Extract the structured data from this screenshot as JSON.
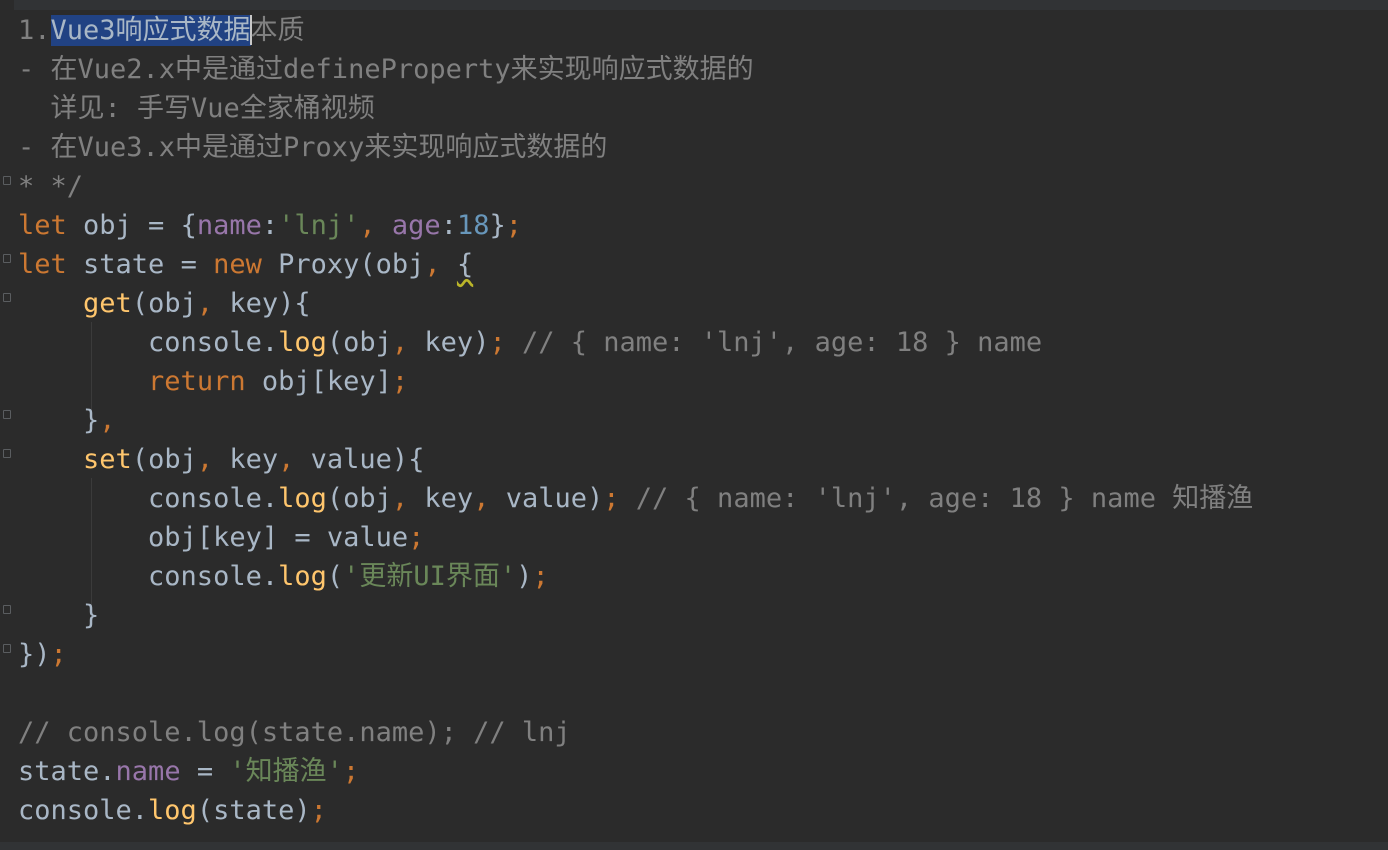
{
  "editor": {
    "lines": [
      {
        "id": "l1",
        "segs": [
          {
            "t": "1.",
            "c": "cmt"
          },
          {
            "t": "Vue3响应式数据",
            "c": "sel"
          },
          {
            "t": "本质",
            "c": "cmt"
          }
        ]
      },
      {
        "id": "l2",
        "segs": [
          {
            "t": "- 在Vue2.x中是通过defineProperty来实现响应式数据的",
            "c": "cmt"
          }
        ]
      },
      {
        "id": "l3",
        "segs": [
          {
            "t": "  详见: 手写Vue全家桶视频",
            "c": "cmt"
          }
        ]
      },
      {
        "id": "l4",
        "segs": [
          {
            "t": "- 在Vue3.x中是通过Proxy来实现响应式数据的",
            "c": "cmt"
          }
        ]
      },
      {
        "id": "l5",
        "segs": [
          {
            "t": "* */",
            "c": "cmt"
          }
        ]
      },
      {
        "id": "l6",
        "segs": [
          {
            "t": "let ",
            "c": "kw"
          },
          {
            "t": "obj = {",
            "c": ""
          },
          {
            "t": "name",
            "c": "prop"
          },
          {
            "t": ":",
            "c": ""
          },
          {
            "t": "'lnj'",
            "c": "str"
          },
          {
            "t": ", ",
            "c": "kw"
          },
          {
            "t": "age",
            "c": "prop"
          },
          {
            "t": ":",
            "c": ""
          },
          {
            "t": "18",
            "c": "num"
          },
          {
            "t": "}",
            "c": ""
          },
          {
            "t": ";",
            "c": "kw"
          }
        ]
      },
      {
        "id": "l7",
        "segs": [
          {
            "t": "let ",
            "c": "kw"
          },
          {
            "t": "state = ",
            "c": ""
          },
          {
            "t": "new ",
            "c": "kw"
          },
          {
            "t": "Proxy(obj",
            "c": ""
          },
          {
            "t": ", ",
            "c": "kw"
          },
          {
            "t": "{",
            "c": "squiggle"
          }
        ]
      },
      {
        "id": "l8",
        "segs": [
          {
            "t": "    ",
            "c": ""
          },
          {
            "t": "get",
            "c": "fn"
          },
          {
            "t": "(obj",
            "c": ""
          },
          {
            "t": ", ",
            "c": "kw"
          },
          {
            "t": "key){",
            "c": ""
          }
        ]
      },
      {
        "id": "l9",
        "segs": [
          {
            "t": "        console.",
            "c": ""
          },
          {
            "t": "log",
            "c": "fnlog"
          },
          {
            "t": "(obj",
            "c": ""
          },
          {
            "t": ", ",
            "c": "kw"
          },
          {
            "t": "key)",
            "c": ""
          },
          {
            "t": "; ",
            "c": "kw"
          },
          {
            "t": "// { name: 'lnj', age: 18 } name",
            "c": "cmt"
          }
        ]
      },
      {
        "id": "l10",
        "segs": [
          {
            "t": "        ",
            "c": ""
          },
          {
            "t": "return ",
            "c": "kw"
          },
          {
            "t": "obj[key]",
            "c": ""
          },
          {
            "t": ";",
            "c": "kw"
          }
        ]
      },
      {
        "id": "l11",
        "segs": [
          {
            "t": "    }",
            "c": ""
          },
          {
            "t": ",",
            "c": "kw"
          }
        ]
      },
      {
        "id": "l12",
        "segs": [
          {
            "t": "    ",
            "c": ""
          },
          {
            "t": "set",
            "c": "fn"
          },
          {
            "t": "(obj",
            "c": ""
          },
          {
            "t": ", ",
            "c": "kw"
          },
          {
            "t": "key",
            "c": ""
          },
          {
            "t": ", ",
            "c": "kw"
          },
          {
            "t": "value){",
            "c": ""
          }
        ]
      },
      {
        "id": "l13",
        "segs": [
          {
            "t": "        console.",
            "c": ""
          },
          {
            "t": "log",
            "c": "fnlog"
          },
          {
            "t": "(obj",
            "c": ""
          },
          {
            "t": ", ",
            "c": "kw"
          },
          {
            "t": "key",
            "c": ""
          },
          {
            "t": ", ",
            "c": "kw"
          },
          {
            "t": "value)",
            "c": ""
          },
          {
            "t": "; ",
            "c": "kw"
          },
          {
            "t": "// { name: 'lnj', age: 18 } name 知播渔",
            "c": "cmt"
          }
        ]
      },
      {
        "id": "l14",
        "segs": [
          {
            "t": "        obj[key] = value",
            "c": ""
          },
          {
            "t": ";",
            "c": "kw"
          }
        ]
      },
      {
        "id": "l15",
        "segs": [
          {
            "t": "        console.",
            "c": ""
          },
          {
            "t": "log",
            "c": "fnlog"
          },
          {
            "t": "(",
            "c": ""
          },
          {
            "t": "'更新UI界面'",
            "c": "str"
          },
          {
            "t": ")",
            "c": ""
          },
          {
            "t": ";",
            "c": "kw"
          }
        ]
      },
      {
        "id": "l16",
        "segs": [
          {
            "t": "    }",
            "c": ""
          }
        ]
      },
      {
        "id": "l17",
        "segs": [
          {
            "t": "})",
            "c": ""
          },
          {
            "t": ";",
            "c": "kw"
          }
        ]
      },
      {
        "id": "l18",
        "segs": [
          {
            "t": "",
            "c": ""
          }
        ]
      },
      {
        "id": "l19",
        "segs": [
          {
            "t": "// console.log(state.name); // lnj",
            "c": "cmt"
          }
        ]
      },
      {
        "id": "l20",
        "segs": [
          {
            "t": "state.",
            "c": ""
          },
          {
            "t": "name",
            "c": "prop"
          },
          {
            "t": " = ",
            "c": ""
          },
          {
            "t": "'知播渔'",
            "c": "str"
          },
          {
            "t": ";",
            "c": "kw"
          }
        ]
      },
      {
        "id": "l21",
        "segs": [
          {
            "t": "console.",
            "c": ""
          },
          {
            "t": "log",
            "c": "fnlog"
          },
          {
            "t": "(state)",
            "c": ""
          },
          {
            "t": ";",
            "c": "kw"
          }
        ]
      }
    ]
  }
}
